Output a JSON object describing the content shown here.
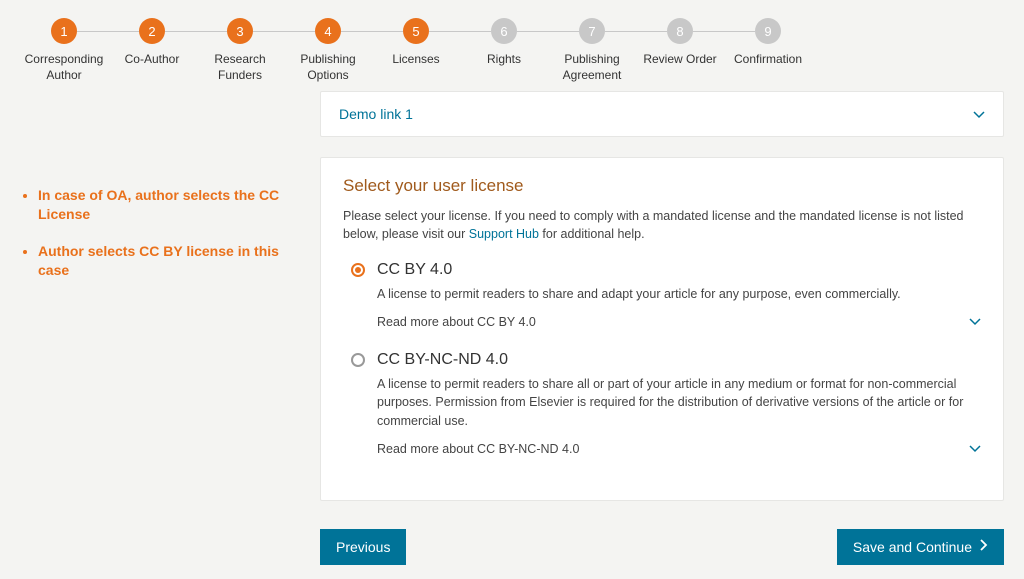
{
  "stepper": {
    "steps": [
      {
        "num": "1",
        "label": "Corresponding Author",
        "active": true
      },
      {
        "num": "2",
        "label": "Co-Author",
        "active": true
      },
      {
        "num": "3",
        "label": "Research Funders",
        "active": true
      },
      {
        "num": "4",
        "label": "Publishing Options",
        "active": true
      },
      {
        "num": "5",
        "label": "Licenses",
        "active": true
      },
      {
        "num": "6",
        "label": "Rights",
        "active": false
      },
      {
        "num": "7",
        "label": "Publishing Agreement",
        "active": false
      },
      {
        "num": "8",
        "label": "Review Order",
        "active": false
      },
      {
        "num": "9",
        "label": "Confirmation",
        "active": false
      }
    ]
  },
  "sidebar": {
    "bullets": [
      "In case of OA, author selects the CC License",
      "Author selects CC BY license in this case"
    ]
  },
  "demo": {
    "link_label": "Demo link 1"
  },
  "license": {
    "heading": "Select your user license",
    "instruction_pre": "Please select your license. If you need to comply with a mandated license and the mandated license is not listed below, please visit our ",
    "support_link": "Support Hub",
    "instruction_post": " for additional help.",
    "options": [
      {
        "title": "CC BY 4.0",
        "description": "A license to permit readers to share and adapt your article for any purpose, even commercially.",
        "readmore": "Read more about CC BY 4.0",
        "selected": true
      },
      {
        "title": "CC BY-NC-ND 4.0",
        "description": "A license to permit readers to share all or part of your article in any medium or format for non-commercial purposes. Permission from Elsevier is required for the distribution of derivative versions of the article or for commercial use.",
        "readmore": "Read more about CC BY-NC-ND 4.0",
        "selected": false
      }
    ]
  },
  "actions": {
    "previous": "Previous",
    "save": "Save and Continue"
  }
}
